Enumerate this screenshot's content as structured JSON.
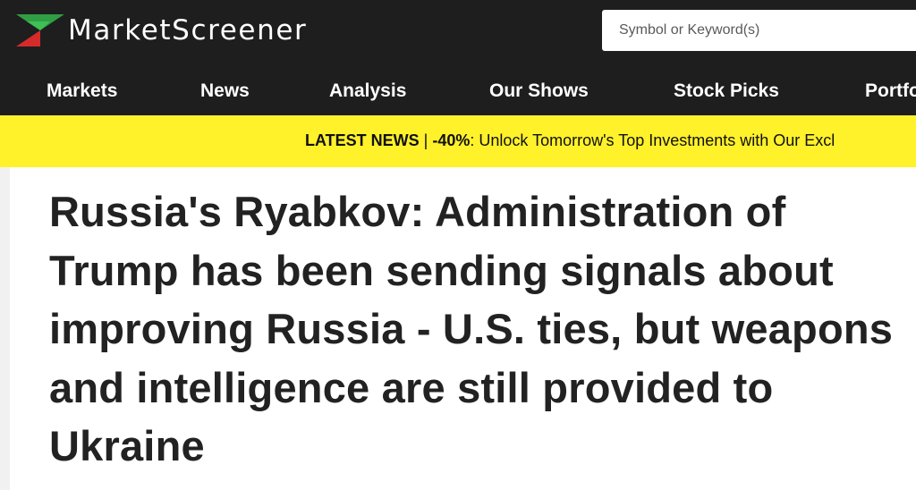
{
  "header": {
    "logo_text": "MarketScreener",
    "search": {
      "placeholder": "Symbol or Keyword(s)",
      "value": ""
    }
  },
  "nav": {
    "items": [
      {
        "label": "Markets"
      },
      {
        "label": "News"
      },
      {
        "label": "Analysis"
      },
      {
        "label": "Our Shows"
      },
      {
        "label": "Stock Picks"
      },
      {
        "label": "Portfo"
      }
    ]
  },
  "ticker": {
    "label": "LATEST NEWS",
    "separator": " | ",
    "highlight": "-40%",
    "text": ": Unlock Tomorrow's Top Investments with Our Excl"
  },
  "article": {
    "headline": "Russia's Ryabkov: Administration of Trump has been sending signals about improving Russia - U.S. ties, but weapons and intelligence are still provided to Ukraine"
  },
  "colors": {
    "header_bg": "#1e1e1e",
    "ticker_bg": "#fff12a",
    "logo_green": "#2f9e44",
    "logo_red": "#d62b2b"
  }
}
